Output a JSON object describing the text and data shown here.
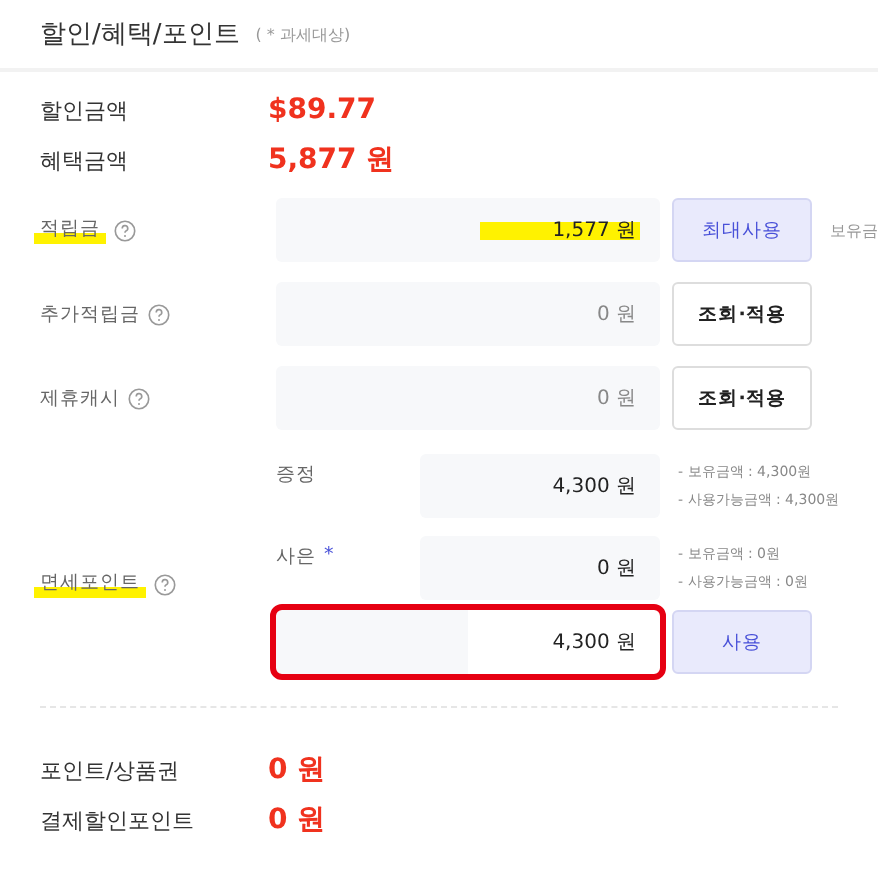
{
  "header": {
    "title": "할인/혜택/포인트",
    "note": "( * 과세대상)"
  },
  "summary": [
    {
      "label": "할인금액",
      "value": "$89.77"
    },
    {
      "label": "혜택금액",
      "value": "5,877 원"
    }
  ],
  "rows": [
    {
      "label": "적립금",
      "highlighted": true,
      "value": "1,577 원",
      "value_dark": true,
      "button": "최대사용",
      "primary": true,
      "side": "보유금"
    },
    {
      "label": "추가적립금",
      "highlighted": false,
      "value": "0 원",
      "value_dark": false,
      "button": "조회·적용",
      "primary": false
    },
    {
      "label": "제휴캐시",
      "highlighted": false,
      "value": "0 원",
      "value_dark": false,
      "button": "조회·적용",
      "primary": false
    }
  ],
  "duty_free": {
    "label": "면세포인트",
    "highlighted": true,
    "items": [
      {
        "label": "증정",
        "value": "4,300 원",
        "notes": [
          "- 보유금액 : 4,300원",
          "- 사용가능금액 : 4,300원"
        ]
      },
      {
        "label": "사은",
        "mark": "*",
        "value": "0 원",
        "notes": [
          "- 보유금액 : 0원",
          "- 사용가능금액 : 0원"
        ]
      }
    ],
    "total": "4,300 원",
    "total_outlined": true,
    "button": "사용"
  },
  "totals": [
    {
      "label": "포인트/상품권",
      "value": "0 원"
    },
    {
      "label": "결제할인포인트",
      "value": "0 원"
    }
  ]
}
